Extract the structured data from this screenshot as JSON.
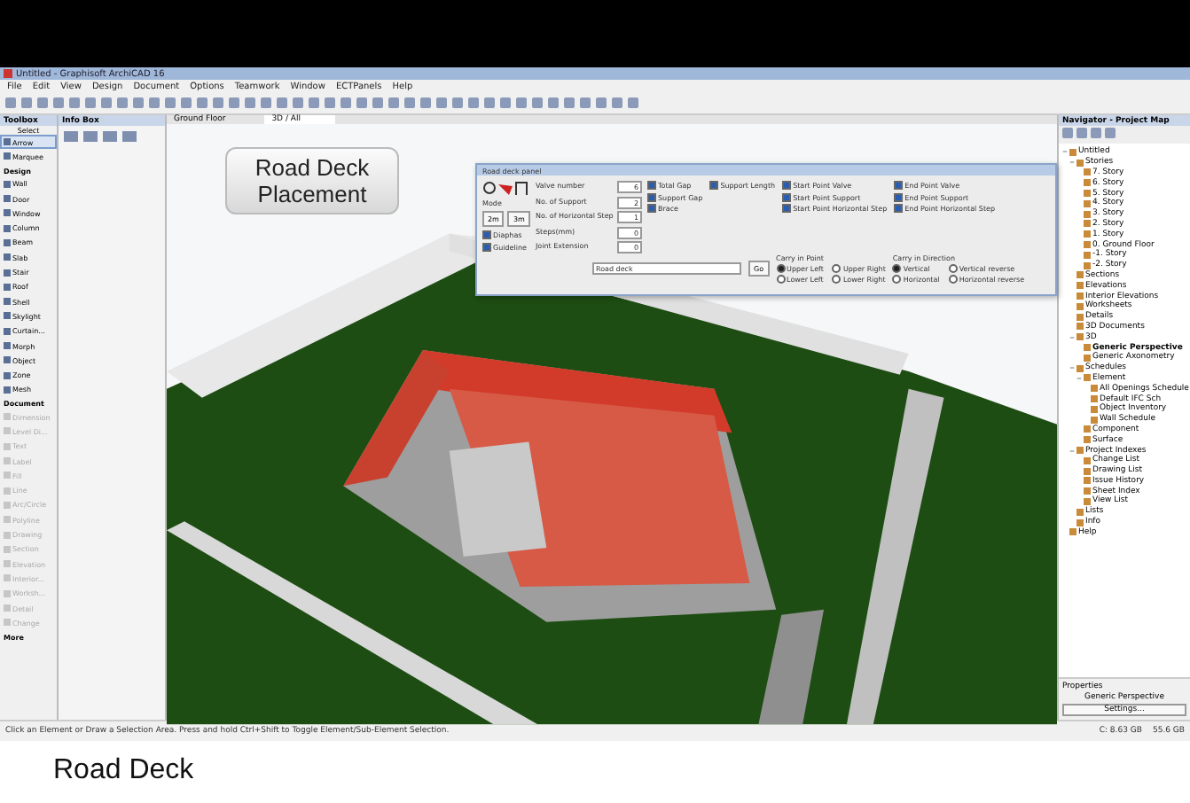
{
  "window": {
    "title": "Untitled - Graphisoft ArchiCAD 16"
  },
  "menu": [
    "File",
    "Edit",
    "View",
    "Design",
    "Document",
    "Options",
    "Teamwork",
    "Window",
    "ECTPanels",
    "Help"
  ],
  "toolbox": {
    "title": "Toolbox",
    "select_label": "Select",
    "items": [
      {
        "label": "Arrow",
        "kind": "tool",
        "selected": true,
        "disabled": false
      },
      {
        "label": "Marquee",
        "kind": "tool",
        "selected": false,
        "disabled": false
      },
      {
        "label": "Design",
        "kind": "header"
      },
      {
        "label": "Wall",
        "kind": "tool",
        "selected": false,
        "disabled": false
      },
      {
        "label": "Door",
        "kind": "tool",
        "selected": false,
        "disabled": false
      },
      {
        "label": "Window",
        "kind": "tool",
        "selected": false,
        "disabled": false
      },
      {
        "label": "Column",
        "kind": "tool",
        "selected": false,
        "disabled": false
      },
      {
        "label": "Beam",
        "kind": "tool",
        "selected": false,
        "disabled": false
      },
      {
        "label": "Slab",
        "kind": "tool",
        "selected": false,
        "disabled": false
      },
      {
        "label": "Stair",
        "kind": "tool",
        "selected": false,
        "disabled": false
      },
      {
        "label": "Roof",
        "kind": "tool",
        "selected": false,
        "disabled": false
      },
      {
        "label": "Shell",
        "kind": "tool",
        "selected": false,
        "disabled": false
      },
      {
        "label": "Skylight",
        "kind": "tool",
        "selected": false,
        "disabled": false
      },
      {
        "label": "Curtain...",
        "kind": "tool",
        "selected": false,
        "disabled": false
      },
      {
        "label": "Morph",
        "kind": "tool",
        "selected": false,
        "disabled": false
      },
      {
        "label": "Object",
        "kind": "tool",
        "selected": false,
        "disabled": false
      },
      {
        "label": "Zone",
        "kind": "tool",
        "selected": false,
        "disabled": false
      },
      {
        "label": "Mesh",
        "kind": "tool",
        "selected": false,
        "disabled": false
      },
      {
        "label": "Document",
        "kind": "header"
      },
      {
        "label": "Dimension",
        "kind": "tool",
        "selected": false,
        "disabled": true
      },
      {
        "label": "Level Di...",
        "kind": "tool",
        "selected": false,
        "disabled": true
      },
      {
        "label": "Text",
        "kind": "tool",
        "selected": false,
        "disabled": true
      },
      {
        "label": "Label",
        "kind": "tool",
        "selected": false,
        "disabled": true
      },
      {
        "label": "Fill",
        "kind": "tool",
        "selected": false,
        "disabled": true
      },
      {
        "label": "Line",
        "kind": "tool",
        "selected": false,
        "disabled": true
      },
      {
        "label": "Arc/Circle",
        "kind": "tool",
        "selected": false,
        "disabled": true
      },
      {
        "label": "Polyline",
        "kind": "tool",
        "selected": false,
        "disabled": true
      },
      {
        "label": "Drawing",
        "kind": "tool",
        "selected": false,
        "disabled": true
      },
      {
        "label": "Section",
        "kind": "tool",
        "selected": false,
        "disabled": true
      },
      {
        "label": "Elevation",
        "kind": "tool",
        "selected": false,
        "disabled": true
      },
      {
        "label": "Interior...",
        "kind": "tool",
        "selected": false,
        "disabled": true
      },
      {
        "label": "Worksh...",
        "kind": "tool",
        "selected": false,
        "disabled": true
      },
      {
        "label": "Detail",
        "kind": "tool",
        "selected": false,
        "disabled": true
      },
      {
        "label": "Change",
        "kind": "tool",
        "selected": false,
        "disabled": true
      },
      {
        "label": "More",
        "kind": "header"
      }
    ]
  },
  "info_box": {
    "title": "Info Box"
  },
  "view_tabs": [
    {
      "label": "Ground Floor",
      "selected": false
    },
    {
      "label": "3D / All",
      "selected": true
    }
  ],
  "caption_box": {
    "lines": [
      "Road Deck",
      "Placement"
    ]
  },
  "dialog": {
    "title": "Road deck panel",
    "mode_label": "Mode",
    "mode_buttons": [
      "2m",
      "3m"
    ],
    "side_checks": [
      {
        "label": "Diaphas",
        "checked": true
      },
      {
        "label": "Guideline",
        "checked": true
      }
    ],
    "fields": [
      {
        "label": "Valve number",
        "value": "6"
      },
      {
        "label": "No. of Support",
        "value": "2"
      },
      {
        "label": "No. of Horizontal Step",
        "value": "1"
      },
      {
        "label": "Steps(mm)",
        "value": "0"
      },
      {
        "label": "Joint Extension",
        "value": "0"
      }
    ],
    "check_columns": [
      [
        {
          "label": "Total Gap",
          "checked": true
        },
        {
          "label": "Support Gap",
          "checked": true
        },
        {
          "label": "Brace",
          "checked": true
        }
      ],
      [
        {
          "label": "Support Length",
          "checked": true
        }
      ],
      [
        {
          "label": "Start Point Valve",
          "checked": true
        },
        {
          "label": "Start Point Support",
          "checked": true
        },
        {
          "label": "Start Point Horizontal Step",
          "checked": true
        }
      ],
      [
        {
          "label": "End Point Valve",
          "checked": true
        },
        {
          "label": "End Point Support",
          "checked": true
        },
        {
          "label": "End Point Horizontal Step",
          "checked": true
        }
      ]
    ],
    "profile": "Road deck",
    "go_button": "Go",
    "carry_in_point": {
      "label": "Carry in Point",
      "options": [
        {
          "label": "Upper Left",
          "selected": true
        },
        {
          "label": "Upper Right",
          "selected": false
        },
        {
          "label": "Lower Left",
          "selected": false
        },
        {
          "label": "Lower Right",
          "selected": false
        }
      ]
    },
    "carry_in_direction": {
      "label": "Carry in Direction",
      "options": [
        {
          "label": "Vertical",
          "selected": true
        },
        {
          "label": "Vertical reverse",
          "selected": false
        },
        {
          "label": "Horizontal",
          "selected": false
        },
        {
          "label": "Horizontal reverse",
          "selected": false
        }
      ]
    }
  },
  "navigator": {
    "title": "Navigator - Project Map",
    "tree": [
      {
        "label": "Untitled",
        "expanded": true,
        "children": [
          {
            "label": "Stories",
            "expanded": true,
            "children": [
              {
                "label": "7. Story"
              },
              {
                "label": "6. Story"
              },
              {
                "label": "5. Story"
              },
              {
                "label": "4. Story"
              },
              {
                "label": "3. Story"
              },
              {
                "label": "2. Story"
              },
              {
                "label": "1. Story"
              },
              {
                "label": "0. Ground Floor"
              },
              {
                "label": "-1. Story"
              },
              {
                "label": "-2. Story"
              }
            ]
          },
          {
            "label": "Sections"
          },
          {
            "label": "Elevations"
          },
          {
            "label": "Interior Elevations"
          },
          {
            "label": "Worksheets"
          },
          {
            "label": "Details"
          },
          {
            "label": "3D Documents"
          },
          {
            "label": "3D",
            "expanded": true,
            "children": [
              {
                "label": "Generic Perspective",
                "selected": true
              },
              {
                "label": "Generic Axonometry"
              }
            ]
          },
          {
            "label": "Schedules",
            "expanded": true,
            "children": [
              {
                "label": "Element",
                "expanded": true,
                "children": [
                  {
                    "label": "All Openings Schedule"
                  },
                  {
                    "label": "Default IFC Sch"
                  },
                  {
                    "label": "Object Inventory"
                  },
                  {
                    "label": "Wall Schedule"
                  }
                ]
              },
              {
                "label": "Component"
              },
              {
                "label": "Surface"
              }
            ]
          },
          {
            "label": "Project Indexes",
            "expanded": true,
            "children": [
              {
                "label": "Change List"
              },
              {
                "label": "Drawing List"
              },
              {
                "label": "Issue History"
              },
              {
                "label": "Sheet Index"
              },
              {
                "label": "View List"
              }
            ]
          },
          {
            "label": "Lists"
          },
          {
            "label": "Info"
          }
        ]
      },
      {
        "label": "Help"
      }
    ]
  },
  "properties": {
    "label": "Properties",
    "value": "Generic Perspective",
    "button": "Settings..."
  },
  "status_bar": {
    "text": "Click an Element or Draw a Selection Area. Press and hold Ctrl+Shift to Toggle Element/Sub-Element Selection.",
    "items": [
      "C: 8.63 GB",
      "55.6 GB"
    ]
  },
  "caption": "Road Deck"
}
